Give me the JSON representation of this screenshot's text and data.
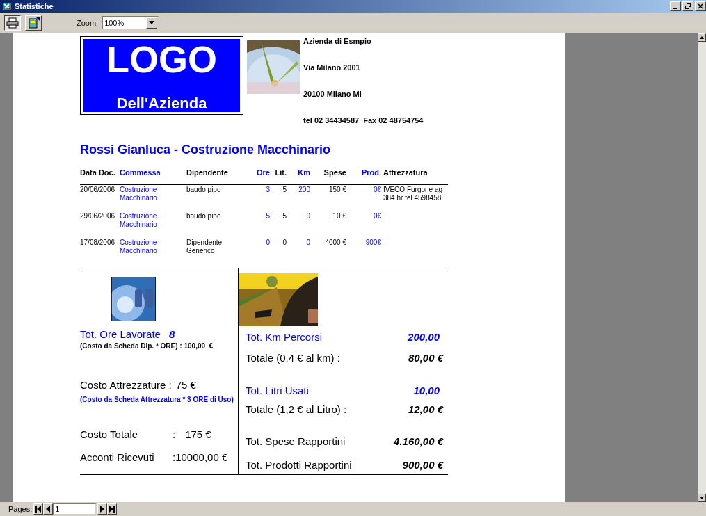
{
  "window": {
    "title": "Statistiche"
  },
  "toolbar": {
    "zoom_label": "Zoom",
    "zoom_value": "100%"
  },
  "report": {
    "logo": {
      "line1": "LOGO",
      "line2": "Dell'Azienda"
    },
    "company": [
      "Azienda di Esmpio",
      "Via Milano 2001",
      "20100 Milano MI",
      "tel 02 34434587  Fax 02 48754754"
    ],
    "title": "Rossi Gianluca - Costruzione Macchinario",
    "table": {
      "columns": [
        {
          "label": "Data Doc.",
          "color": "#000000"
        },
        {
          "label": "Commessa",
          "color": "#0000ff"
        },
        {
          "label": "Dipendente",
          "color": "#000000"
        },
        {
          "label": "Ore",
          "color": "#0000ff"
        },
        {
          "label": "Lit.",
          "color": "#000000"
        },
        {
          "label": "Km",
          "color": "#0000ff"
        },
        {
          "label": "Spese",
          "color": "#000000"
        },
        {
          "label": "Prod.",
          "color": "#0000ff"
        },
        {
          "label": "Attrezzatura",
          "color": "#000000"
        }
      ],
      "rows": [
        {
          "cells": [
            "20/06/2006",
            "Costruzione Macchinario",
            "baudo pipo",
            "3",
            "5",
            "200",
            "150 €",
            "0€",
            "IVECO Furgone ag 384 hr tel 4598458"
          ]
        },
        {
          "cells": [
            "29/06/2006",
            "Costruzione Macchinario",
            "baudo pipo",
            "5",
            "5",
            "0",
            "10 €",
            "0€"
          ]
        },
        {
          "cells": [
            "17/08/2006",
            "Costruzione Macchinario",
            "Dipendente Generico",
            "0",
            "0",
            "0",
            "4000 €",
            "900€"
          ]
        }
      ]
    },
    "summary": {
      "left": [
        {
          "kind": "heading",
          "label": "Tot. Ore Lavorate",
          "value": "8"
        },
        {
          "kind": "note",
          "text": "(Costo da Scheda Dip. * ORE) : 100,00  €",
          "color": "#000000"
        },
        {
          "kind": "line",
          "label": "Costo Attrezzature :",
          "value": "75 €"
        },
        {
          "kind": "note",
          "text": "(Costo da Scheda Attrezzatura * 3 ORE di Uso)",
          "color": "#0000ff"
        },
        {
          "kind": "line",
          "label": "Costo Totale",
          "sep": ":",
          "value": "175 €"
        },
        {
          "kind": "line",
          "label": "Acconti Ricevuti",
          "value": ":10000,00 €"
        }
      ],
      "right": [
        {
          "kind": "heading",
          "label": "Tot. Km Percorsi",
          "value": "200,00"
        },
        {
          "kind": "total",
          "label": "Totale (0,4 € al km) :",
          "value": "80,00 €"
        },
        {
          "kind": "heading",
          "label": "Tot. Litri Usati",
          "value": "10,00"
        },
        {
          "kind": "total",
          "label": "Totale (1,2 € al Litro) :",
          "value": "12,00 €"
        },
        {
          "kind": "total",
          "label": "Tot. Spese Rapportini",
          "value": "4.160,00 €"
        },
        {
          "kind": "total",
          "label": "Tot. Prodotti Rapportini",
          "value": "900,00 €"
        }
      ]
    }
  },
  "status": {
    "label": "Pages:",
    "page": "1"
  }
}
